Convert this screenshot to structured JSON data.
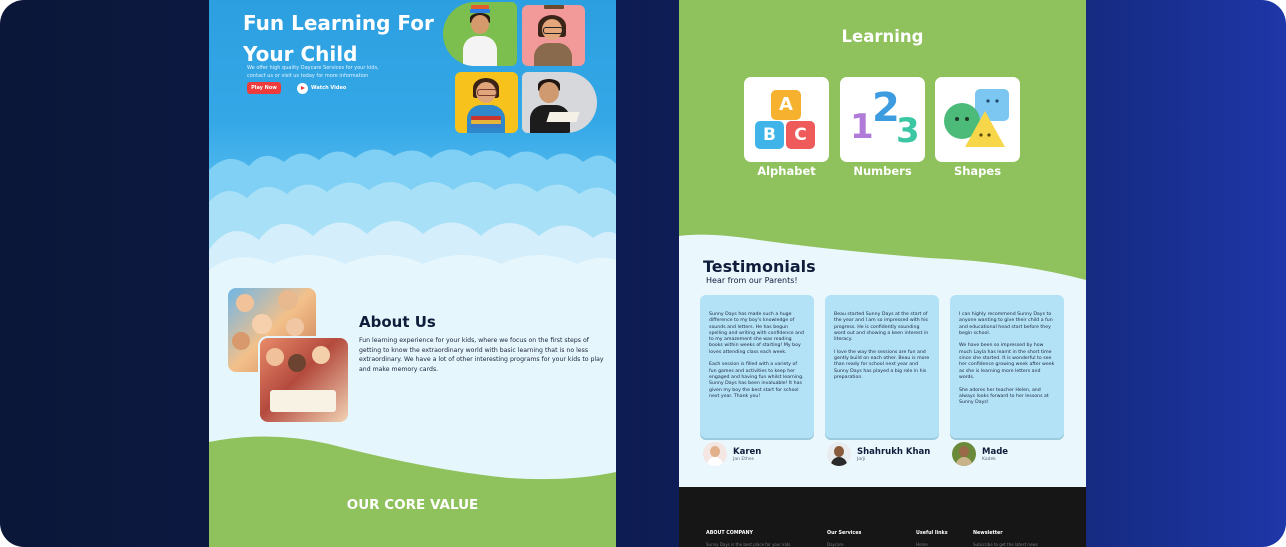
{
  "colors": {
    "hero_blue": "#34a8e7",
    "play_red": "#ef3b3b",
    "grass_green": "#8fc15d",
    "card_blue": "#b3e2f7",
    "navy_text": "#0f1d3b",
    "footer_dark": "#161616"
  },
  "left": {
    "hero": {
      "title": "Fun Learning For Your Child",
      "description": "We offer high quality Daycare Services for your kids, contact us or visit us today for more information",
      "play_button": "Play Now",
      "watch_button": "Watch Video",
      "watch_icon": "play-circle-icon"
    },
    "about": {
      "title": "About Us",
      "text": "Fun learning experience for your kids, where we focus on the first steps of getting to know the extraordinary world with basic learning that is no less extraordinary. We have a lot of other interesting programs for your kids to play and make  memory cards."
    },
    "core_value": "OUR CORE VALUE"
  },
  "right": {
    "learning": {
      "title": "Learning",
      "cards": [
        {
          "label": "Alphabet",
          "icon": "abc-blocks-icon"
        },
        {
          "label": "Numbers",
          "icon": "numbers-icon"
        },
        {
          "label": "Shapes",
          "icon": "shapes-icon"
        }
      ],
      "alphabet_letters": [
        "A",
        "B",
        "C"
      ],
      "number_digits": [
        "1",
        "2",
        "3"
      ]
    },
    "testimonials": {
      "title": "Testimonials",
      "subtitle": "Hear from our Parents!",
      "items": [
        {
          "text": "Sunny Days has made such a huge difference to my boy's knowledge of sounds and letters. He has begun spelling and writing with confidence and to my amazement she was reading books within weeks of starting! My boy loves attending class each week.\n\nEach session is filled with a variety of fun games and activities to keep her engaged and having fun whilst learning. Sunny Days has been invaluable! It has given my boy the best start for school next year. Thank you!",
          "name": "Karen",
          "role": "Jan Ethes"
        },
        {
          "text": "Beau started Sunny Days at the start of the year and I am so impressed with his progress. He is confidently sounding word out and showing a keen interest in literacy.\n\nI love the way the sessions are fun and gently build on each other. Beau is more than ready for school next year and Sunny Days has played a big role in his preparation.",
          "name": "Shahrukh Khan",
          "role": "Jorji"
        },
        {
          "text": "I can highly recommend Sunny Days to anyone wanting to give their child a fun and educational head start before they begin school.\n\nWe have been so impressed by how much Layla has learnt in the short time since she started. It is wonderful to see her confidence growing week after week as she is learning more letters and words.\n\nShe adores her teacher Helen, and always looks forward to her lessons at Sunny Days!",
          "name": "Made",
          "role": "Kadek"
        }
      ]
    },
    "footer": {
      "columns": [
        {
          "heading": "ABOUT COMPANY",
          "sub": "Sunny Days is the best place for your kids"
        },
        {
          "heading": "Our Services",
          "sub": "Daycare"
        },
        {
          "heading": "Useful links",
          "sub": "Home"
        },
        {
          "heading": "Newsletter",
          "sub": "Subscribe to get the latest news"
        }
      ]
    }
  }
}
